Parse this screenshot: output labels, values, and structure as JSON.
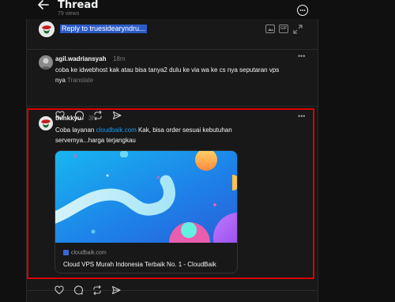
{
  "header": {
    "title": "Thread",
    "views": "79 views"
  },
  "reply": {
    "placeholder": "Reply to truesidearyndru..."
  },
  "posts": [
    {
      "username": "agil.wadriansyah",
      "time": "18m",
      "text": "coba ke idwebhost kak atau bisa tanya2 dulu ke via wa ke cs nya seputaran vps",
      "text_line2": "nya",
      "translate": "Translate"
    },
    {
      "username": "thinkkyu",
      "time": "3h",
      "text_before_link": "Coba layanan ",
      "link": "cloudbaik.com",
      "text_after_link": " Kak, bisa order sesuai kebutuhan",
      "text_line2": "servernya...harga terjangkau",
      "card": {
        "domain": "cloudbaik.com",
        "title": "Cloud VPS Murah Indonesia Terbaik No. 1 - CloudBaik"
      }
    }
  ],
  "colors": {
    "background": "#101010",
    "panel": "#181818",
    "highlight": "#d90000",
    "link": "#1d9bf0",
    "selection": "#2d5cc7"
  },
  "icons": {
    "back": "arrow-left-icon",
    "more": "more-circle-icon",
    "image": "image-icon",
    "gif": "gif-icon",
    "expand": "expand-icon",
    "like": "heart-icon",
    "comment": "comment-icon",
    "repost": "repost-icon",
    "share": "send-icon"
  }
}
